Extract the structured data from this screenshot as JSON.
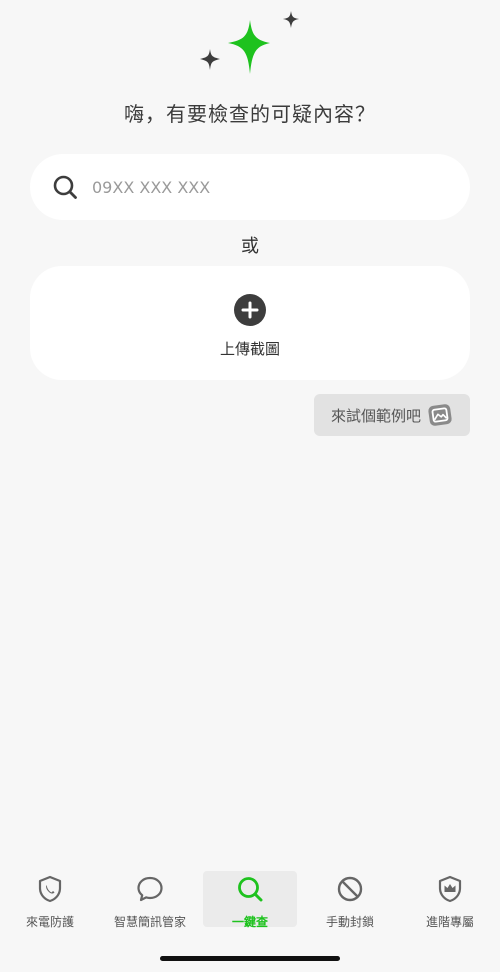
{
  "header": {
    "headline": "嗨，有要檢查的可疑內容？"
  },
  "search": {
    "placeholder": "09XX XXX XXX",
    "value": ""
  },
  "divider": {
    "or_label": "或"
  },
  "upload": {
    "label": "上傳截圖"
  },
  "example": {
    "label": "來試個範例吧"
  },
  "tabs": [
    {
      "label": "來電防護",
      "icon": "shield-phone-icon",
      "active": false
    },
    {
      "label": "智慧簡訊管家",
      "icon": "chat-bubble-icon",
      "active": false
    },
    {
      "label": "一鍵查",
      "icon": "search-icon",
      "active": true
    },
    {
      "label": "手動封鎖",
      "icon": "block-icon",
      "active": false
    },
    {
      "label": "進階專屬",
      "icon": "crown-shield-icon",
      "active": false
    }
  ],
  "colors": {
    "accent": "#1ec21e",
    "background": "#f7f7f7",
    "card": "#ffffff",
    "icon_dark": "#3d3d3d"
  }
}
